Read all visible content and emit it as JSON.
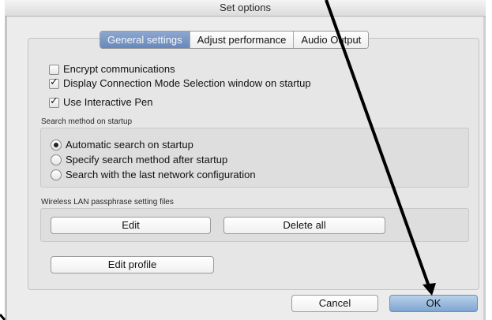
{
  "window": {
    "title": "Set options"
  },
  "tabs": [
    {
      "label": "General settings",
      "selected": true
    },
    {
      "label": "Adjust performance",
      "selected": false
    },
    {
      "label": "Audio Output",
      "selected": false
    }
  ],
  "checkboxes": [
    {
      "label": "Encrypt communications",
      "checked": false
    },
    {
      "label": "Display Connection Mode Selection window on startup",
      "checked": true
    },
    {
      "label": "Use Interactive Pen",
      "checked": true
    }
  ],
  "search_method": {
    "label": "Search method on startup",
    "options": [
      {
        "label": "Automatic search on startup",
        "selected": true
      },
      {
        "label": "Specify search method after startup",
        "selected": false
      },
      {
        "label": "Search with the last network configuration",
        "selected": false
      }
    ]
  },
  "wireless": {
    "label": "Wireless LAN passphrase setting files",
    "edit_label": "Edit",
    "delete_label": "Delete all"
  },
  "edit_profile_label": "Edit profile",
  "footer": {
    "cancel_label": "Cancel",
    "ok_label": "OK"
  },
  "colors": {
    "accent": "#6788bc",
    "default_button": "#7ea5d2",
    "annotation_arrow": "#000000"
  }
}
